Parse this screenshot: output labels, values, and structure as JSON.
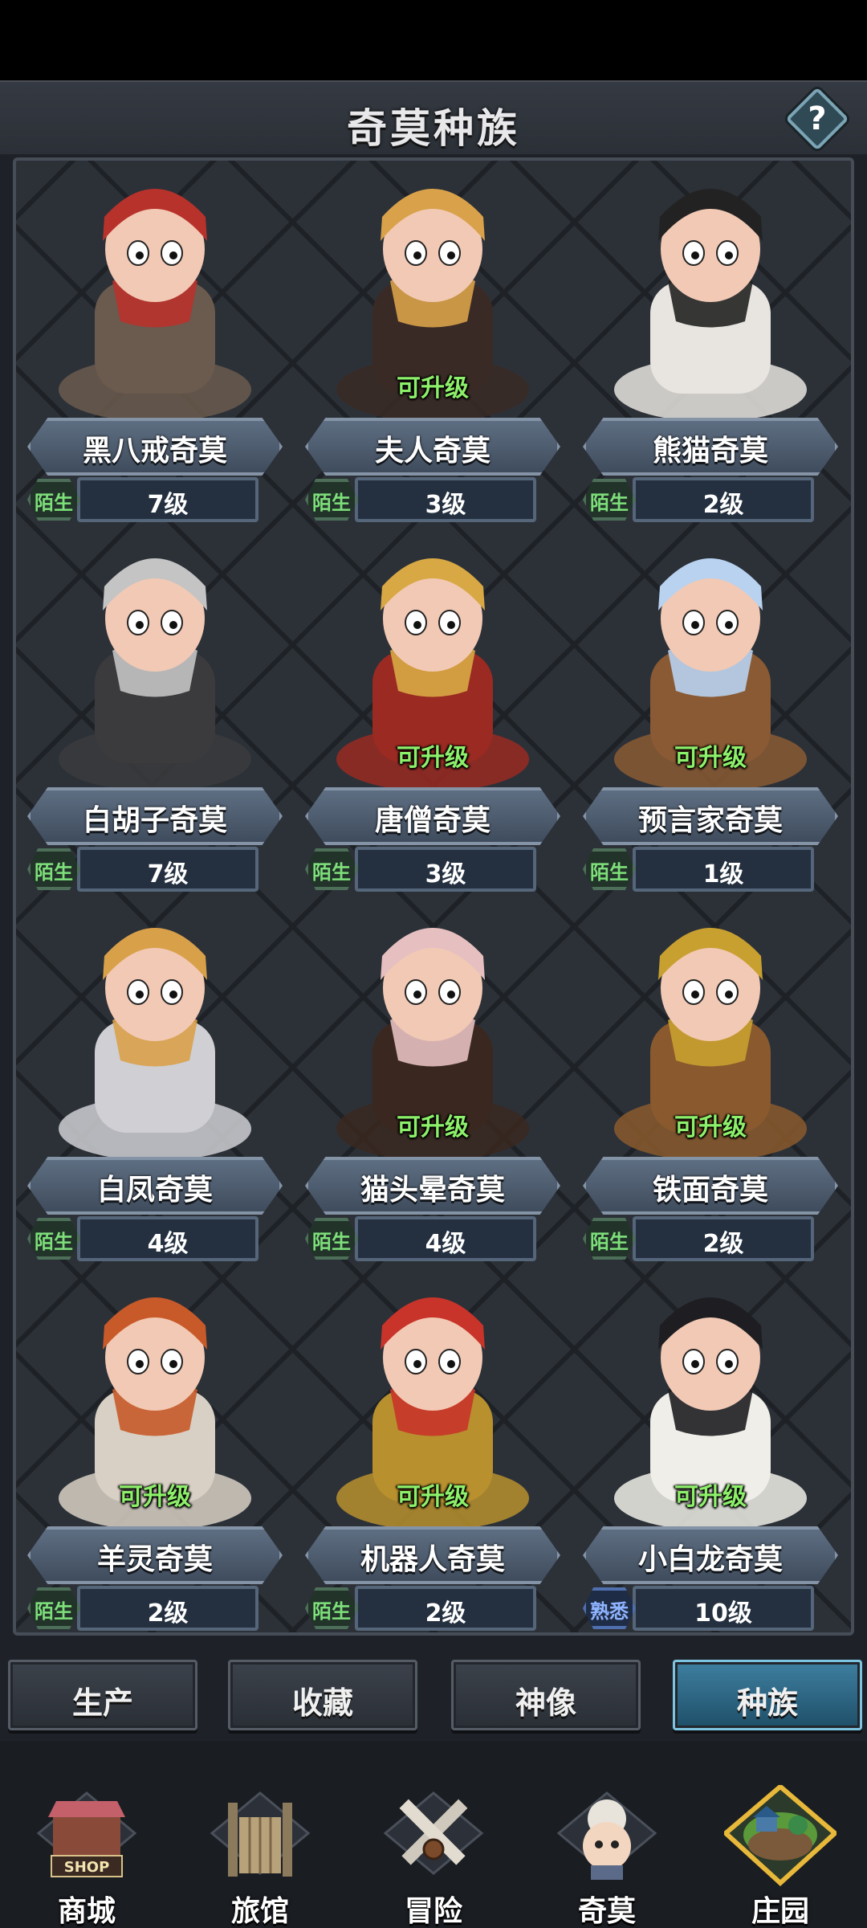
{
  "header": {
    "title": "奇莫种族",
    "help_label": "?"
  },
  "creatures": [
    {
      "name": "黑八戒奇莫",
      "level": "7级",
      "relation": "陌生",
      "upgradable": false,
      "color": "#6b5a4e",
      "accent": "#b8322c"
    },
    {
      "name": "夫人奇莫",
      "level": "3级",
      "relation": "陌生",
      "upgradable": true,
      "upgrade_label": "可升级",
      "color": "#3a2a26",
      "accent": "#d9a24a"
    },
    {
      "name": "熊猫奇莫",
      "level": "2级",
      "relation": "陌生",
      "upgradable": false,
      "color": "#e8e4df",
      "accent": "#222222"
    },
    {
      "name": "白胡子奇莫",
      "level": "7级",
      "relation": "陌生",
      "upgradable": false,
      "color": "#3b3b3d",
      "accent": "#c4c4c4"
    },
    {
      "name": "唐僧奇莫",
      "level": "3级",
      "relation": "陌生",
      "upgradable": true,
      "upgrade_label": "可升级",
      "color": "#9a2a22",
      "accent": "#d8a844"
    },
    {
      "name": "预言家奇莫",
      "level": "1级",
      "relation": "陌生",
      "upgradable": true,
      "upgrade_label": "可升级",
      "color": "#8a5a34",
      "accent": "#b8d2f0"
    },
    {
      "name": "白凤奇莫",
      "level": "4级",
      "relation": "陌生",
      "upgradable": false,
      "color": "#cfcfd4",
      "accent": "#d9a04a"
    },
    {
      "name": "猫头晕奇莫",
      "level": "4级",
      "relation": "陌生",
      "upgradable": true,
      "upgrade_label": "可升级",
      "color": "#3a2820",
      "accent": "#e6c0c0"
    },
    {
      "name": "铁面奇莫",
      "level": "2级",
      "relation": "陌生",
      "upgradable": true,
      "upgrade_label": "可升级",
      "color": "#8a5a2e",
      "accent": "#c8a030"
    },
    {
      "name": "羊灵奇莫",
      "level": "2级",
      "relation": "陌生",
      "upgradable": true,
      "upgrade_label": "可升级",
      "color": "#d8d0c4",
      "accent": "#c85a2a"
    },
    {
      "name": "机器人奇莫",
      "level": "2级",
      "relation": "陌生",
      "upgradable": true,
      "upgrade_label": "可升级",
      "color": "#b8902e",
      "accent": "#c8342a"
    },
    {
      "name": "小白龙奇莫",
      "level": "10级",
      "relation": "熟悉",
      "upgradable": true,
      "upgrade_label": "可升级",
      "color": "#f0eee8",
      "accent": "#1e1e22"
    }
  ],
  "tabs": [
    {
      "label": "生产",
      "active": false
    },
    {
      "label": "收藏",
      "active": false
    },
    {
      "label": "神像",
      "active": false
    },
    {
      "label": "种族",
      "active": true
    }
  ],
  "nav": [
    {
      "label": "商城",
      "icon": "shop-icon",
      "icon_text": "SHOP"
    },
    {
      "label": "旅馆",
      "icon": "inn-gate-icon"
    },
    {
      "label": "冒险",
      "icon": "crossed-swords-icon"
    },
    {
      "label": "奇莫",
      "icon": "kimo-face-icon"
    },
    {
      "label": "庄园",
      "icon": "manor-island-icon"
    }
  ]
}
